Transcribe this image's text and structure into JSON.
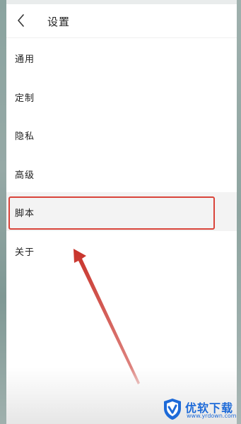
{
  "header": {
    "title": "设置",
    "back_icon": "chevron-left-icon"
  },
  "menu": {
    "items": [
      {
        "label": "通用"
      },
      {
        "label": "定制"
      },
      {
        "label": "隐私"
      },
      {
        "label": "高级"
      },
      {
        "label": "脚本"
      },
      {
        "label": "关于"
      }
    ]
  },
  "annotation": {
    "highlight_color": "#d9443a"
  },
  "watermark": {
    "title": "优软下载",
    "url": "www.yrdown.com",
    "brand_color": "#1d6ad8"
  }
}
